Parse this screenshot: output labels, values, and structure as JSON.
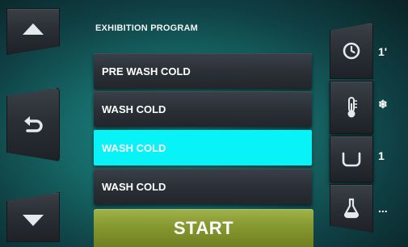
{
  "program": {
    "title": "EXHIBITION PROGRAM",
    "rows": [
      {
        "label": "PRE WASH COLD",
        "selected": false
      },
      {
        "label": "WASH COLD",
        "selected": false
      },
      {
        "label": "WASH COLD",
        "selected": true
      },
      {
        "label": "WASH COLD",
        "selected": false
      }
    ],
    "start_label": "START"
  },
  "nav": {
    "up_icon": "arrow-up-icon",
    "back_icon": "back-return-icon",
    "down_icon": "arrow-down-icon"
  },
  "params": [
    {
      "icon": "clock-icon",
      "value": "1'"
    },
    {
      "icon": "thermometer-icon",
      "value": "❄"
    },
    {
      "icon": "tub-icon",
      "value": "1"
    },
    {
      "icon": "flask-icon",
      "value": "..."
    }
  ],
  "colors": {
    "selected_row": "#08f3f8",
    "start_button": "#86982f",
    "background": "#176b6a"
  }
}
